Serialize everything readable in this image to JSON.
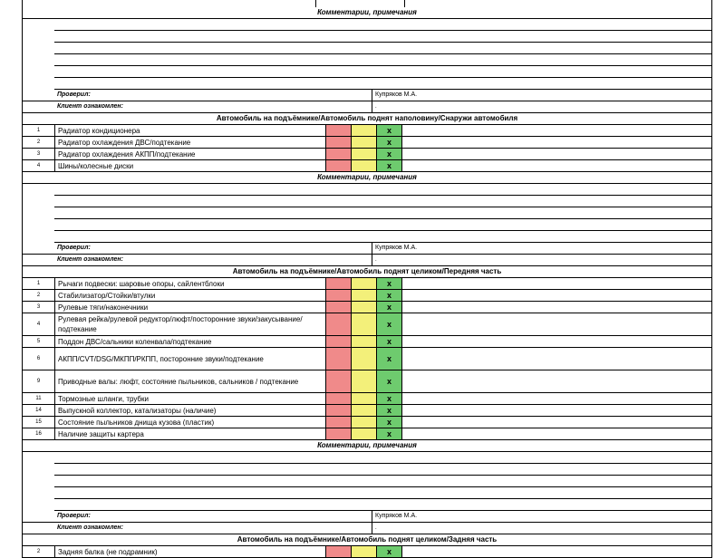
{
  "sections": [
    {
      "type": "comments",
      "comments_header": "Комментарии, примечания",
      "lines": 6,
      "checked_label": "Проверил:",
      "checked_value": "Купряков М.А.",
      "client_label": "Клиент ознакомлен:",
      "client_value": "."
    },
    {
      "type": "checklist",
      "header": "Автомобиль на подъёмнике/Автомобиль поднят наполовину/Снаружи автомобиля",
      "items": [
        {
          "num": "1",
          "name": "Радиатор кондиционера",
          "mark": "x",
          "tall": false
        },
        {
          "num": "2",
          "name": "Радиатор охлаждения ДВС/подтекание",
          "mark": "x",
          "tall": false
        },
        {
          "num": "3",
          "name": "Радиатор охлаждения АКПП/подтекание",
          "mark": "x",
          "tall": false
        },
        {
          "num": "4",
          "name": "Шины/колесные диски",
          "mark": "x",
          "tall": false
        }
      ],
      "comments_header": "Комментарии, примечания",
      "lines": 5,
      "checked_label": "Проверил:",
      "checked_value": "Купряков М.А.",
      "client_label": "Клиент ознакомлен:",
      "client_value": "."
    },
    {
      "type": "checklist",
      "header": "Автомобиль на подъёмнике/Автомобиль поднят целиком/Передняя часть",
      "items": [
        {
          "num": "1",
          "name": "Рычаги подвески: шаровые опоры, сайлентблоки",
          "mark": "x",
          "tall": false
        },
        {
          "num": "2",
          "name": "Стабилизатор/Стойки/втулки",
          "mark": "x",
          "tall": false
        },
        {
          "num": "3",
          "name": "Рулевые тяги/наконечники",
          "mark": "x",
          "tall": false
        },
        {
          "num": "4",
          "name": "Рулевая рейка/рулевой редуктор/люфт/посторонние звуки/закусывание/подтекание",
          "mark": "x",
          "tall": true
        },
        {
          "num": "5",
          "name": "Поддон ДВС/сальники коленвала/подтекание",
          "mark": "x",
          "tall": false
        },
        {
          "num": "6",
          "name": "АКПП/CVT/DSG/МКПП/РКПП, посторонние звуки/подтекание",
          "mark": "x",
          "tall": true
        },
        {
          "num": "9",
          "name": "Приводные валы: люфт, состояние пыльников, сальников / подтекание",
          "mark": "x",
          "tall": true
        },
        {
          "num": "11",
          "name": "Тормозные шланги, трубки",
          "mark": "x",
          "tall": false
        },
        {
          "num": "14",
          "name": "Выпускной коллектор, катализаторы (наличие)",
          "mark": "x",
          "tall": false
        },
        {
          "num": "15",
          "name": "Состояние пыльников днища кузова (пластик)",
          "mark": "x",
          "tall": false
        },
        {
          "num": "16",
          "name": "Наличие защиты картера",
          "mark": "x",
          "tall": false
        }
      ],
      "comments_header": "Комментарии, примечания",
      "lines": 5,
      "checked_label": "Проверил:",
      "checked_value": "Купряков М.А.",
      "client_label": "Клиент ознакомлен:",
      "client_value": "."
    },
    {
      "type": "checklist_open",
      "header": "Автомобиль на подъёмнике/Автомобиль поднят целиком/Задняя часть",
      "items": [
        {
          "num": "2",
          "name": "Задняя балка (не подрамник)",
          "mark": "x",
          "tall": false
        }
      ]
    }
  ],
  "colors": {
    "bad": "#f08a8a",
    "warn": "#f3f07a",
    "ok": "#6ecb6e"
  }
}
